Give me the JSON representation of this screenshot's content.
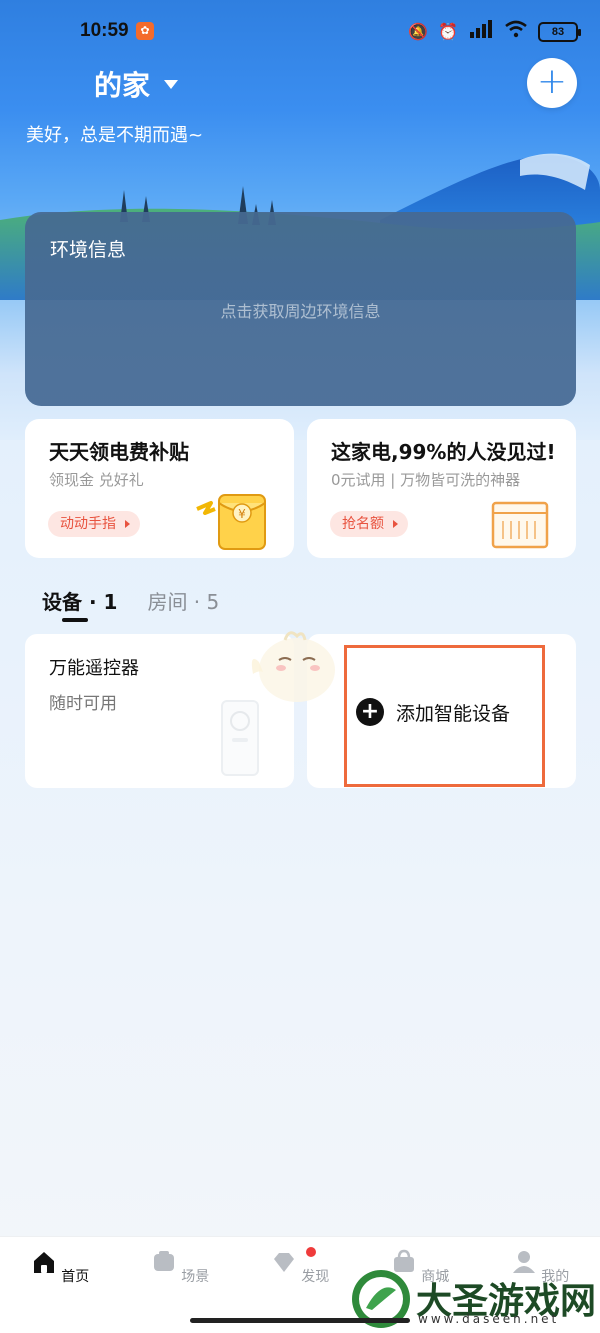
{
  "status_bar": {
    "time": "10:59",
    "battery": "83"
  },
  "header": {
    "home_name": "的家",
    "greeting": "美好，总是不期而遇~",
    "add_icon": "plus-icon"
  },
  "environment": {
    "title": "环境信息",
    "hint": "点击获取周边环境信息"
  },
  "promos": [
    {
      "title": "天天领电费补贴",
      "subtitle": "领现金 兑好礼",
      "tag": "动动手指"
    },
    {
      "title": "这家电,99%的人没见过!",
      "subtitle": "0元试用 | 万物皆可洗的神器",
      "tag": "抢名额"
    }
  ],
  "tabs": [
    {
      "label": "设备 · 1"
    },
    {
      "label": "房间 · 5"
    }
  ],
  "devices": [
    {
      "name": "万能遥控器",
      "status": "随时可用"
    }
  ],
  "add_device": {
    "label": "添加智能设备"
  },
  "bottom_nav": [
    {
      "label": "首页",
      "icon": "home-icon"
    },
    {
      "label": "场景",
      "icon": "scene-icon"
    },
    {
      "label": "发现",
      "icon": "discover-icon"
    },
    {
      "label": "商城",
      "icon": "shop-icon"
    },
    {
      "label": "我的",
      "icon": "profile-icon"
    }
  ],
  "watermark": {
    "name": "大圣游戏网",
    "url": "www.daseen.net"
  },
  "colors": {
    "accent": "#2f87ea",
    "highlight_border": "#ee6a3c",
    "promo_tag": "#e8533f",
    "badge": "#ef3b3b"
  }
}
